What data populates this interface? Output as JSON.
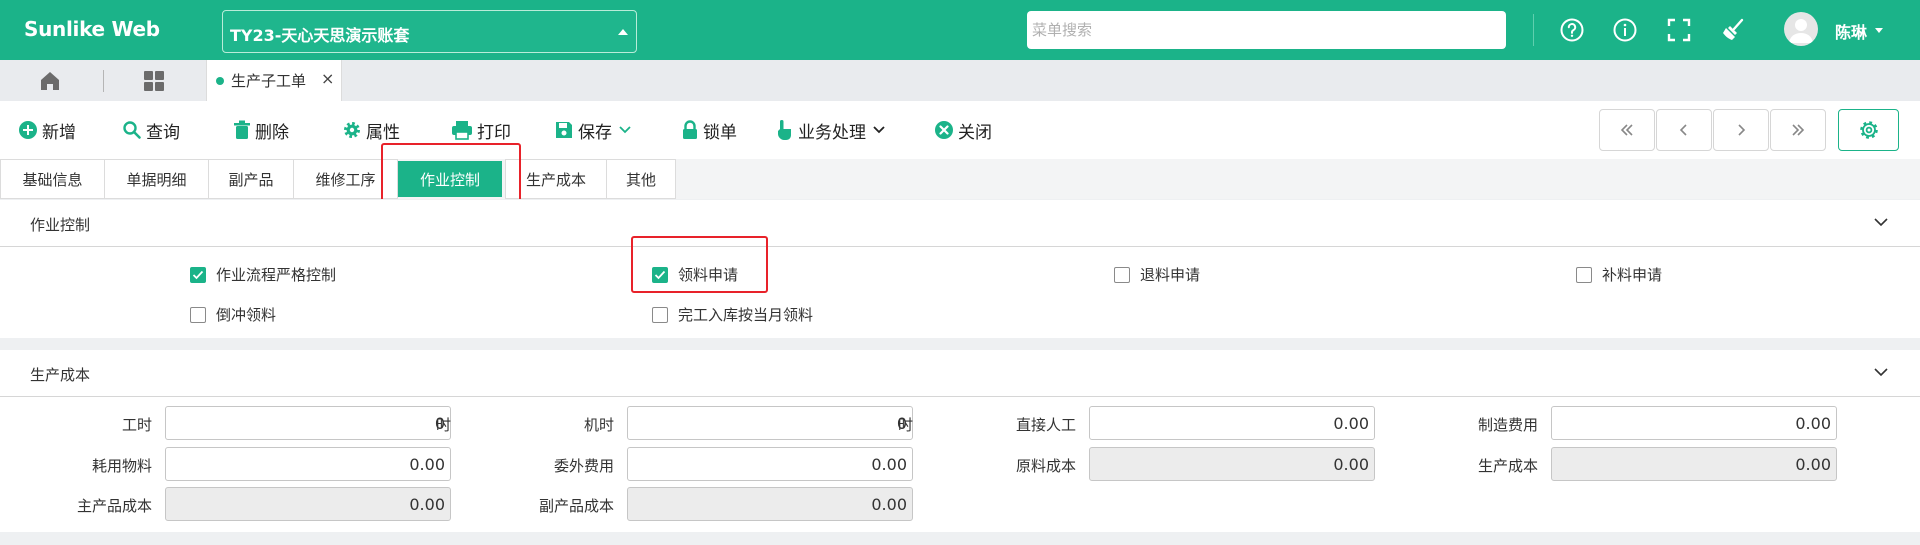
{
  "header": {
    "brand": "Sunlike Web",
    "account_set": "TY23-天心天思演示账套",
    "menu_search_placeholder": "菜单搜索",
    "user_name": "陈琳",
    "icons": [
      "help-icon",
      "info-icon",
      "fullscreen-icon",
      "clean-icon"
    ]
  },
  "tabs": {
    "open_tab_label": "生产子工单",
    "close_glyph": "×"
  },
  "toolbar": {
    "new": "新增",
    "query": "查询",
    "delete": "删除",
    "properties": "属性",
    "print": "打印",
    "save": "保存",
    "lock": "锁单",
    "business": "业务处理",
    "close": "关闭"
  },
  "section_tabs": [
    "基础信息",
    "单据明细",
    "副产品",
    "维修工序",
    "作业控制",
    "生产成本",
    "其他"
  ],
  "active_section_tab": "作业控制",
  "job_control": {
    "title": "作业控制",
    "options": [
      {
        "label": "作业流程严格控制",
        "checked": true
      },
      {
        "label": "领料申请",
        "checked": true
      },
      {
        "label": "退料申请",
        "checked": false
      },
      {
        "label": "补料申请",
        "checked": false
      },
      {
        "label": "倒冲领料",
        "checked": false
      },
      {
        "label": "完工入库按当月领料",
        "checked": false
      }
    ]
  },
  "production_cost": {
    "title": "生产成本",
    "fields": {
      "work_hours": {
        "label": "工时",
        "value": "0",
        "unit": "时"
      },
      "machine_hours": {
        "label": "机时",
        "value": "0",
        "unit": "时"
      },
      "direct_labor": {
        "label": "直接人工",
        "value": "0.00"
      },
      "manufacturing_expense": {
        "label": "制造费用",
        "value": "0.00"
      },
      "consumable_material": {
        "label": "耗用物料",
        "value": "0.00"
      },
      "outsourcing_expense": {
        "label": "委外费用",
        "value": "0.00"
      },
      "raw_material_cost": {
        "label": "原料成本",
        "value": "0.00"
      },
      "production_cost": {
        "label": "生产成本",
        "value": "0.00"
      },
      "main_product_cost": {
        "label": "主产品成本",
        "value": "0.00"
      },
      "byproduct_cost": {
        "label": "副产品成本",
        "value": "0.00"
      }
    }
  },
  "colors": {
    "brand_green": "#1bb389",
    "highlight_red": "#e8222a"
  }
}
